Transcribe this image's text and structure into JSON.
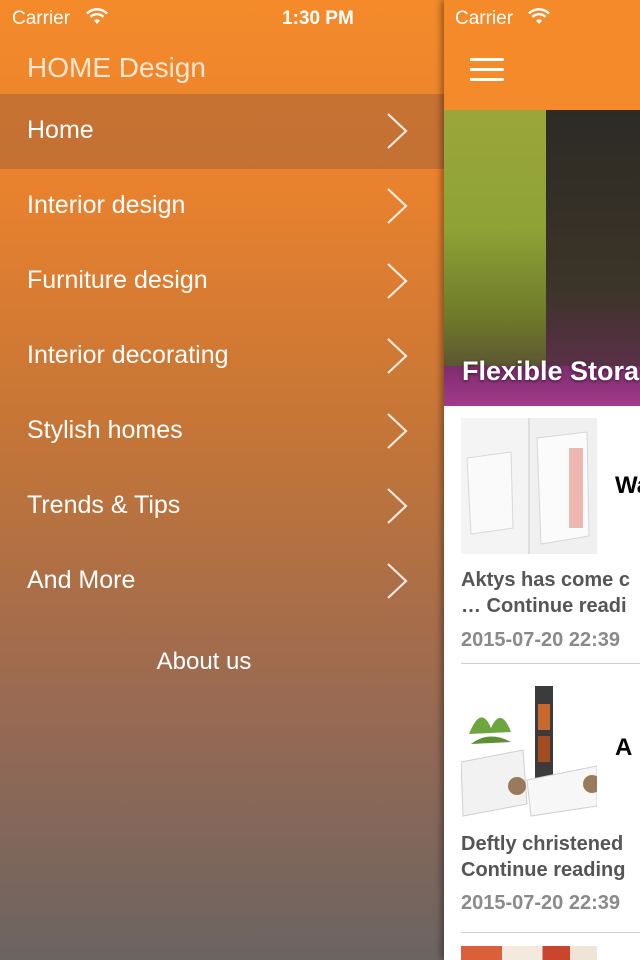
{
  "status_bar": {
    "carrier": "Carrier",
    "time": "1:30 PM"
  },
  "drawer": {
    "app_title": "HOME Design",
    "menu_items": [
      {
        "label": "Home",
        "active": true
      },
      {
        "label": "Interior design"
      },
      {
        "label": "Furniture design"
      },
      {
        "label": "Interior decorating"
      },
      {
        "label": "Stylish homes"
      },
      {
        "label": "Trends & Tips"
      },
      {
        "label": "And More"
      }
    ],
    "about_label": "About us"
  },
  "panel": {
    "carrier": "Carrier",
    "menu_icon": "hamburger-icon",
    "hero_title": "Flexible Stora",
    "articles": [
      {
        "title": "Wa",
        "excerpt_line1": "Aktys has come c",
        "excerpt_line2": "… Continue readi",
        "date": "2015-07-20 22:39"
      },
      {
        "title": "A",
        "excerpt_line1": "Deftly christened",
        "excerpt_line2": "Continue reading",
        "date": "2015-07-20 22:39"
      }
    ]
  },
  "colors": {
    "accent": "#f48a2a",
    "drawer_bottom": "#6b6462"
  }
}
